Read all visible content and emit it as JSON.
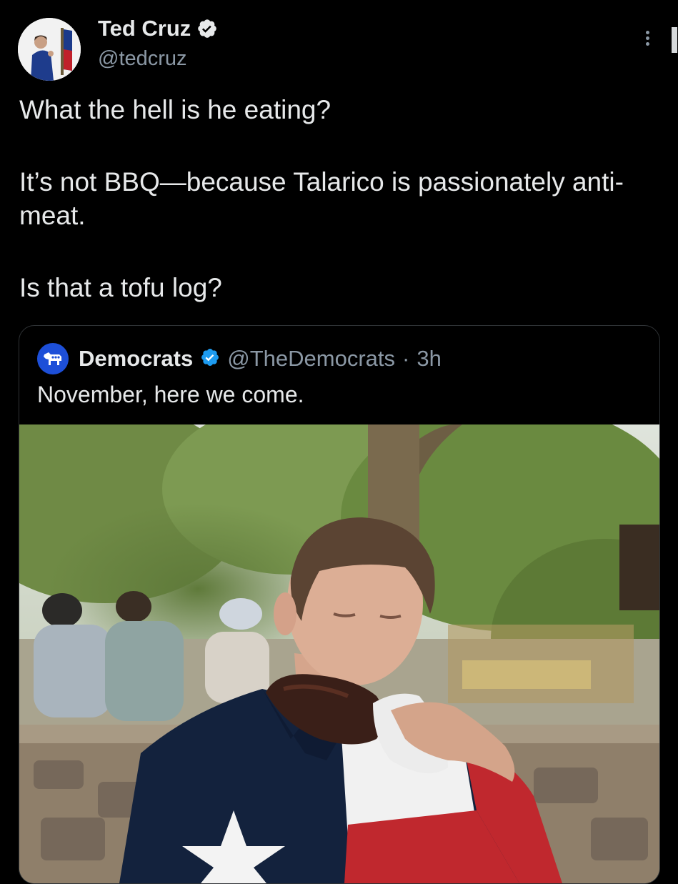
{
  "tweet": {
    "author_name": "Ted Cruz",
    "author_handle": "@tedcruz",
    "text_lines": [
      "What the hell is he eating?",
      "It’s not BBQ—because Talarico is passionately anti-meat.",
      "Is that a tofu log?"
    ]
  },
  "quoted_tweet": {
    "author_name": "Democrats",
    "author_handle": "@TheDemocrats",
    "separator": "·",
    "time": "3h",
    "text": "November, here we come."
  },
  "icons": {
    "verified": "verified-badge-icon",
    "more": "more-options-icon"
  },
  "colors": {
    "background": "#000000",
    "text_primary": "#e7e9ea",
    "text_secondary": "#8b98a5",
    "verified_blue": "#1d9bf0",
    "democrats_blue": "#1d4fd8",
    "card_border": "#2f3336"
  }
}
